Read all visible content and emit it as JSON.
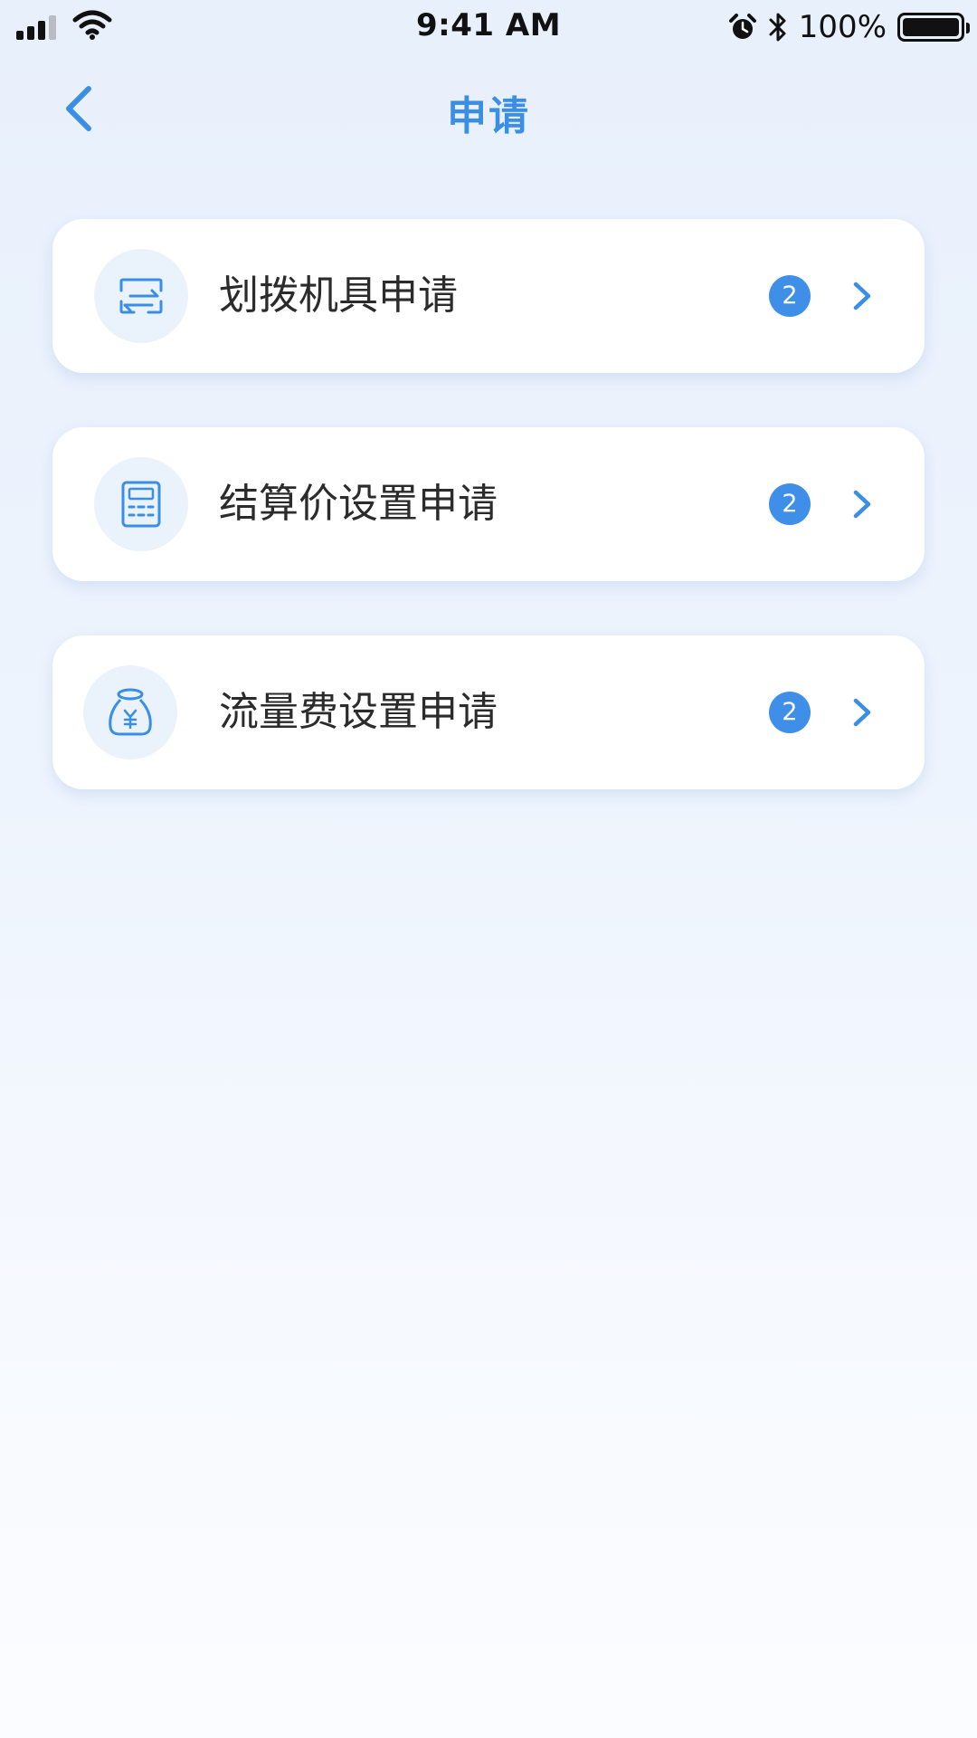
{
  "status_bar": {
    "time": "9:41 AM",
    "battery_text": "100%",
    "battery_level_percent": 100,
    "icons": [
      "signal-icon",
      "wifi-icon",
      "alarm-icon",
      "bluetooth-icon",
      "battery-icon"
    ]
  },
  "header": {
    "title": "申请",
    "back_icon": "back-chevron-icon"
  },
  "colors": {
    "accent": "#3a8ee6",
    "badge": "#3f8fe8",
    "icon_bg": "#eaf2fc",
    "card_bg": "#ffffff",
    "text_primary": "#2b2b2b"
  },
  "items": [
    {
      "label": "划拨机具申请",
      "badge": "2",
      "icon": "transfer-icon"
    },
    {
      "label": "结算价设置申请",
      "badge": "2",
      "icon": "calculator-icon"
    },
    {
      "label": "流量费设置申请",
      "badge": "2",
      "icon": "money-bag-icon"
    }
  ]
}
